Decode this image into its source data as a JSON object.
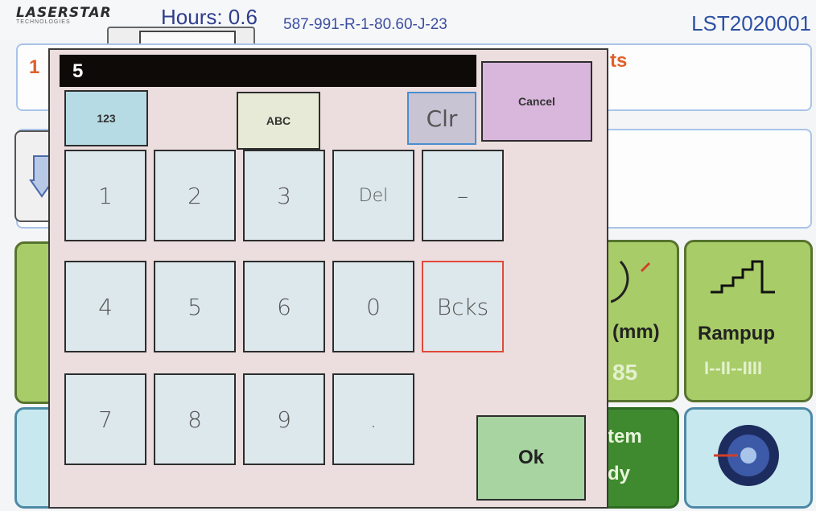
{
  "header": {
    "logo_main": "LASERSTAR",
    "logo_sub": "TECHNOLOGIES",
    "hours": "Hours: 0.6",
    "job_code": "587-991-R-1-80.60-J-23",
    "serial": "LST2020001"
  },
  "background": {
    "info_left": "1",
    "info_right": "ts",
    "tiles": {
      "mm_label": "(mm)",
      "mm_value": "85",
      "rampup_label": "Rampup",
      "rampup_sub": "I--II--IIII",
      "system_label_1": "tem",
      "system_label_2": "dy"
    }
  },
  "keypad": {
    "display_value": "5",
    "mode_numeric": "123",
    "mode_alpha": "ABC",
    "clear": "Clr",
    "cancel": "Cancel",
    "keys": {
      "k1": "1",
      "k2": "2",
      "k3": "3",
      "del": "Del",
      "minus": "–",
      "k4": "4",
      "k5": "5",
      "k6": "6",
      "k0": "0",
      "backspace": "Bcks",
      "k7": "7",
      "k8": "8",
      "k9": "9",
      "dot": "."
    },
    "ok": "Ok"
  },
  "colors": {
    "display_bg": "#0e0a08",
    "modal_bg": "#ecdede",
    "key_bg": "#dde8ec",
    "ok_bg": "#a8d4a2",
    "cancel_bg": "#d9b6dc",
    "tile_green": "#a8cc68",
    "accent_orange": "#e0602a"
  }
}
